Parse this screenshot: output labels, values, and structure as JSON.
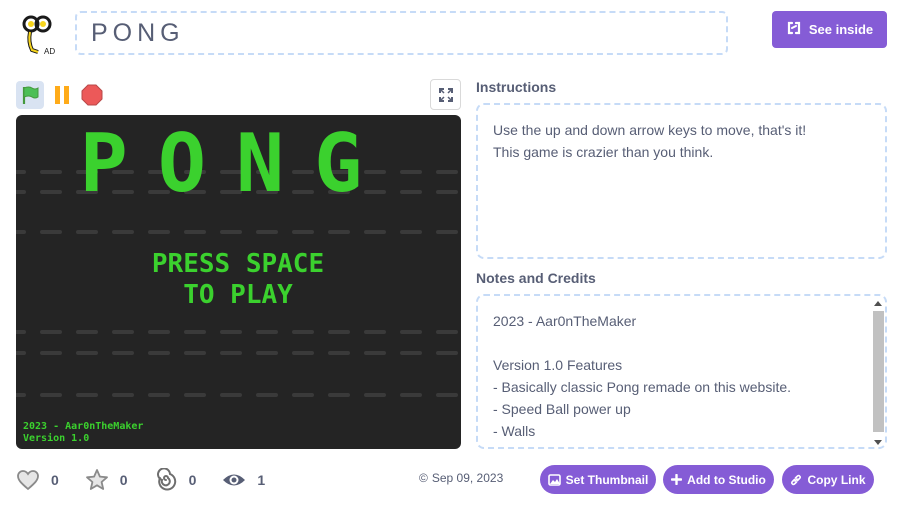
{
  "header": {
    "title": "PONG",
    "see_inside_label": "See inside"
  },
  "controls": {
    "green_flag_icon": "green-flag-icon",
    "pause_icon": "pause-icon",
    "stop_icon": "stop-icon",
    "fullscreen_icon": "fullscreen-icon"
  },
  "stage": {
    "game_title": "PONG",
    "press_line1": "PRESS SPACE",
    "press_line2": "TO PLAY",
    "credit_line1": "2023 - Aar0nTheMaker",
    "credit_line2": "Version 1.0",
    "accent_color": "#3bd12e",
    "background_color": "#242424"
  },
  "instructions": {
    "heading": "Instructions",
    "lines": [
      "Use the up and down arrow keys to move, that's it!",
      "This game is crazier than you think."
    ]
  },
  "notes": {
    "heading": "Notes and Credits",
    "lines": [
      "2023 - Aar0nTheMaker",
      "",
      "Version 1.0 Features",
      "- Basically classic Pong remade on this website.",
      "- Speed Ball power up",
      "- Walls"
    ]
  },
  "stats": {
    "loves": "0",
    "favorites": "0",
    "remixes": "0",
    "views": "1"
  },
  "meta": {
    "date": "Sep 09, 2023"
  },
  "actions": {
    "set_thumbnail": "Set Thumbnail",
    "add_to_studio": "Add to Studio",
    "copy_link": "Copy Link"
  },
  "colors": {
    "accent": "#855cd6",
    "dashed_border": "#c6dbf7",
    "text": "#575e75"
  }
}
